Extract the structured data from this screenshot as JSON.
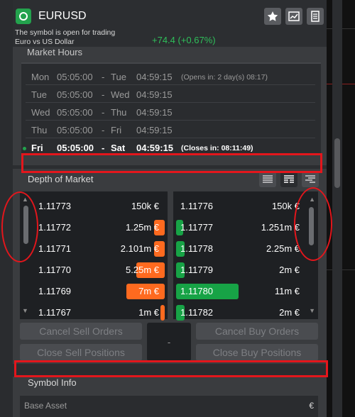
{
  "header": {
    "symbol": "EURUSD",
    "status": "The symbol is open for trading",
    "description": "Euro vs US Dollar",
    "change": "+74.4 (+0.67%)"
  },
  "market_hours": {
    "title": "Market Hours",
    "rows": [
      {
        "d1": "Mon",
        "t1": "05:05:00",
        "sep": "-",
        "d2": "Tue",
        "t2": "04:59:15",
        "note": "(Opens in: 2 day(s) 08:17)"
      },
      {
        "d1": "Tue",
        "t1": "05:05:00",
        "sep": "-",
        "d2": "Wed",
        "t2": "04:59:15",
        "note": ""
      },
      {
        "d1": "Wed",
        "t1": "05:05:00",
        "sep": "-",
        "d2": "Thu",
        "t2": "04:59:15",
        "note": ""
      },
      {
        "d1": "Thu",
        "t1": "05:05:00",
        "sep": "-",
        "d2": "Fri",
        "t2": "04:59:15",
        "note": ""
      },
      {
        "d1": "Fri",
        "t1": "05:05:00",
        "sep": "-",
        "d2": "Sat",
        "t2": "04:59:15",
        "note": "(Closes in: 08:11:49)"
      }
    ]
  },
  "depth_of_market": {
    "title": "Depth of Market",
    "sell": [
      {
        "price": "1.11773",
        "volume": "150k €",
        "fill": 0.0
      },
      {
        "price": "1.11772",
        "volume": "1.25m €",
        "fill": 0.07
      },
      {
        "price": "1.11771",
        "volume": "2.101m €",
        "fill": 0.07
      },
      {
        "price": "1.11770",
        "volume": "5.25m €",
        "fill": 0.19
      },
      {
        "price": "1.11769",
        "volume": "7m €",
        "fill": 0.26
      },
      {
        "price": "1.11767",
        "volume": "1m €",
        "fill": 0.03
      }
    ],
    "buy": [
      {
        "price": "1.11776",
        "volume": "150k €",
        "fill": 0.0
      },
      {
        "price": "1.11777",
        "volume": "1.251m €",
        "fill": 0.05
      },
      {
        "price": "1.11778",
        "volume": "2.25m €",
        "fill": 0.06
      },
      {
        "price": "1.11779",
        "volume": "2m €",
        "fill": 0.06
      },
      {
        "price": "1.11780",
        "volume": "11m €",
        "fill": 0.43
      },
      {
        "price": "1.11782",
        "volume": "2m €",
        "fill": 0.06
      }
    ]
  },
  "actions": {
    "cancel_sell": "Cancel Sell Orders",
    "close_sell": "Close Sell Positions",
    "cancel_buy": "Cancel Buy Orders",
    "close_buy": "Close Buy Positions",
    "center": "-"
  },
  "symbol_info": {
    "title": "Symbol Info",
    "base_asset_label": "Base Asset",
    "base_asset_value": "€"
  },
  "colors": {
    "sell": "#ff6a1f",
    "buy": "#17a346",
    "positive_change": "#2fbf5a",
    "annotation": "#e3161c"
  }
}
